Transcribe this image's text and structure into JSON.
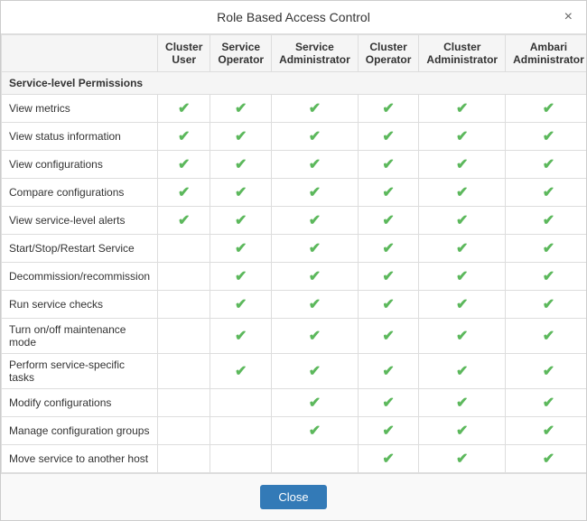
{
  "modal": {
    "title": "Role Based Access Control",
    "close_x_label": "×",
    "close_btn_label": "Close"
  },
  "table": {
    "columns": [
      {
        "id": "permission",
        "label": ""
      },
      {
        "id": "cluster_user",
        "label": "Cluster User"
      },
      {
        "id": "service_operator",
        "label": "Service Operator"
      },
      {
        "id": "service_administrator",
        "label": "Service Administrator"
      },
      {
        "id": "cluster_operator",
        "label": "Cluster Operator"
      },
      {
        "id": "cluster_administrator",
        "label": "Cluster Administrator"
      },
      {
        "id": "ambari_administrator",
        "label": "Ambari Administrator"
      }
    ],
    "sections": [
      {
        "header": "Service-level Permissions",
        "rows": [
          {
            "label": "View metrics",
            "cluster_user": true,
            "service_operator": true,
            "service_administrator": true,
            "cluster_operator": true,
            "cluster_administrator": true,
            "ambari_administrator": true
          },
          {
            "label": "View status information",
            "cluster_user": true,
            "service_operator": true,
            "service_administrator": true,
            "cluster_operator": true,
            "cluster_administrator": true,
            "ambari_administrator": true
          },
          {
            "label": "View configurations",
            "cluster_user": true,
            "service_operator": true,
            "service_administrator": true,
            "cluster_operator": true,
            "cluster_administrator": true,
            "ambari_administrator": true
          },
          {
            "label": "Compare configurations",
            "cluster_user": true,
            "service_operator": true,
            "service_administrator": true,
            "cluster_operator": true,
            "cluster_administrator": true,
            "ambari_administrator": true
          },
          {
            "label": "View service-level alerts",
            "cluster_user": true,
            "service_operator": true,
            "service_administrator": true,
            "cluster_operator": true,
            "cluster_administrator": true,
            "ambari_administrator": true
          },
          {
            "label": "Start/Stop/Restart Service",
            "cluster_user": false,
            "service_operator": true,
            "service_administrator": true,
            "cluster_operator": true,
            "cluster_administrator": true,
            "ambari_administrator": true
          },
          {
            "label": "Decommission/recommission",
            "cluster_user": false,
            "service_operator": true,
            "service_administrator": true,
            "cluster_operator": true,
            "cluster_administrator": true,
            "ambari_administrator": true
          },
          {
            "label": "Run service checks",
            "cluster_user": false,
            "service_operator": true,
            "service_administrator": true,
            "cluster_operator": true,
            "cluster_administrator": true,
            "ambari_administrator": true
          },
          {
            "label": "Turn on/off maintenance mode",
            "cluster_user": false,
            "service_operator": true,
            "service_administrator": true,
            "cluster_operator": true,
            "cluster_administrator": true,
            "ambari_administrator": true
          },
          {
            "label": "Perform service-specific tasks",
            "cluster_user": false,
            "service_operator": true,
            "service_administrator": true,
            "cluster_operator": true,
            "cluster_administrator": true,
            "ambari_administrator": true
          },
          {
            "label": "Modify configurations",
            "cluster_user": false,
            "service_operator": false,
            "service_administrator": true,
            "cluster_operator": true,
            "cluster_administrator": true,
            "ambari_administrator": true
          },
          {
            "label": "Manage configuration groups",
            "cluster_user": false,
            "service_operator": false,
            "service_administrator": true,
            "cluster_operator": true,
            "cluster_administrator": true,
            "ambari_administrator": true
          },
          {
            "label": "Move service to another host",
            "cluster_user": false,
            "service_operator": false,
            "service_administrator": false,
            "cluster_operator": true,
            "cluster_administrator": true,
            "ambari_administrator": true
          }
        ]
      }
    ]
  }
}
